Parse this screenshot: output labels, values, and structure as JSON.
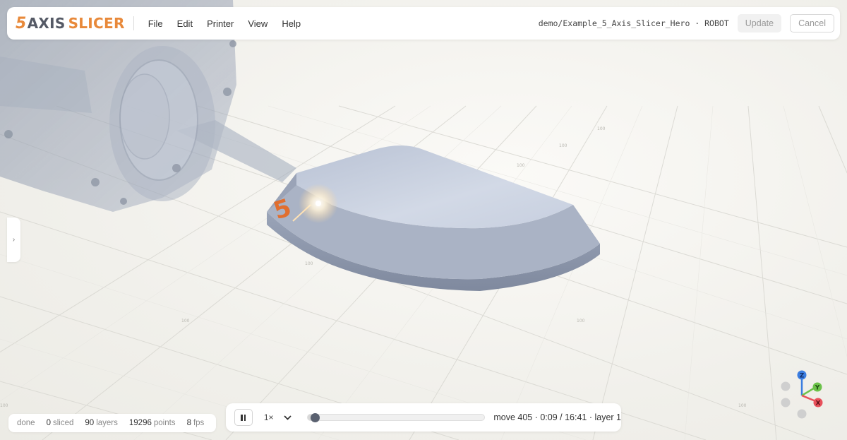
{
  "app": {
    "logo_five": "5",
    "logo_axis": "AXIS",
    "logo_slicer": "SLICER",
    "colors": {
      "brand_orange": "#e8893a",
      "brand_gray": "#555a66"
    }
  },
  "menu": {
    "items": [
      {
        "label": "File"
      },
      {
        "label": "Edit"
      },
      {
        "label": "Printer"
      },
      {
        "label": "View"
      },
      {
        "label": "Help"
      }
    ]
  },
  "header": {
    "project_path": "demo/Example_5_Axis_Slicer_Hero · ROBOT",
    "update_label": "Update",
    "cancel_label": "Cancel"
  },
  "sidebar": {
    "toggle_icon": "chevron-right-icon",
    "toggle_glyph": "›"
  },
  "status": {
    "state": "done",
    "sliced_count": "0",
    "sliced_label": "sliced",
    "layers_count": "90",
    "layers_label": "layers",
    "points_count": "19296",
    "points_label": "points",
    "fps_count": "8",
    "fps_label": "fps"
  },
  "playback": {
    "speed": "1×",
    "progress_fraction": 0.04,
    "status_text": "move 405 · 0:09 / 16:41 · layer 1"
  },
  "gizmo": {
    "z_label": "Z",
    "y_label": "Y",
    "x_label": "X",
    "colors": {
      "x": "#e8505b",
      "y": "#6cc24a",
      "z": "#3b7de0"
    }
  },
  "scene": {
    "grid_labels": [
      "100",
      "100",
      "100",
      "100",
      "100",
      "100",
      "100",
      "100"
    ],
    "part_mark": "5"
  }
}
